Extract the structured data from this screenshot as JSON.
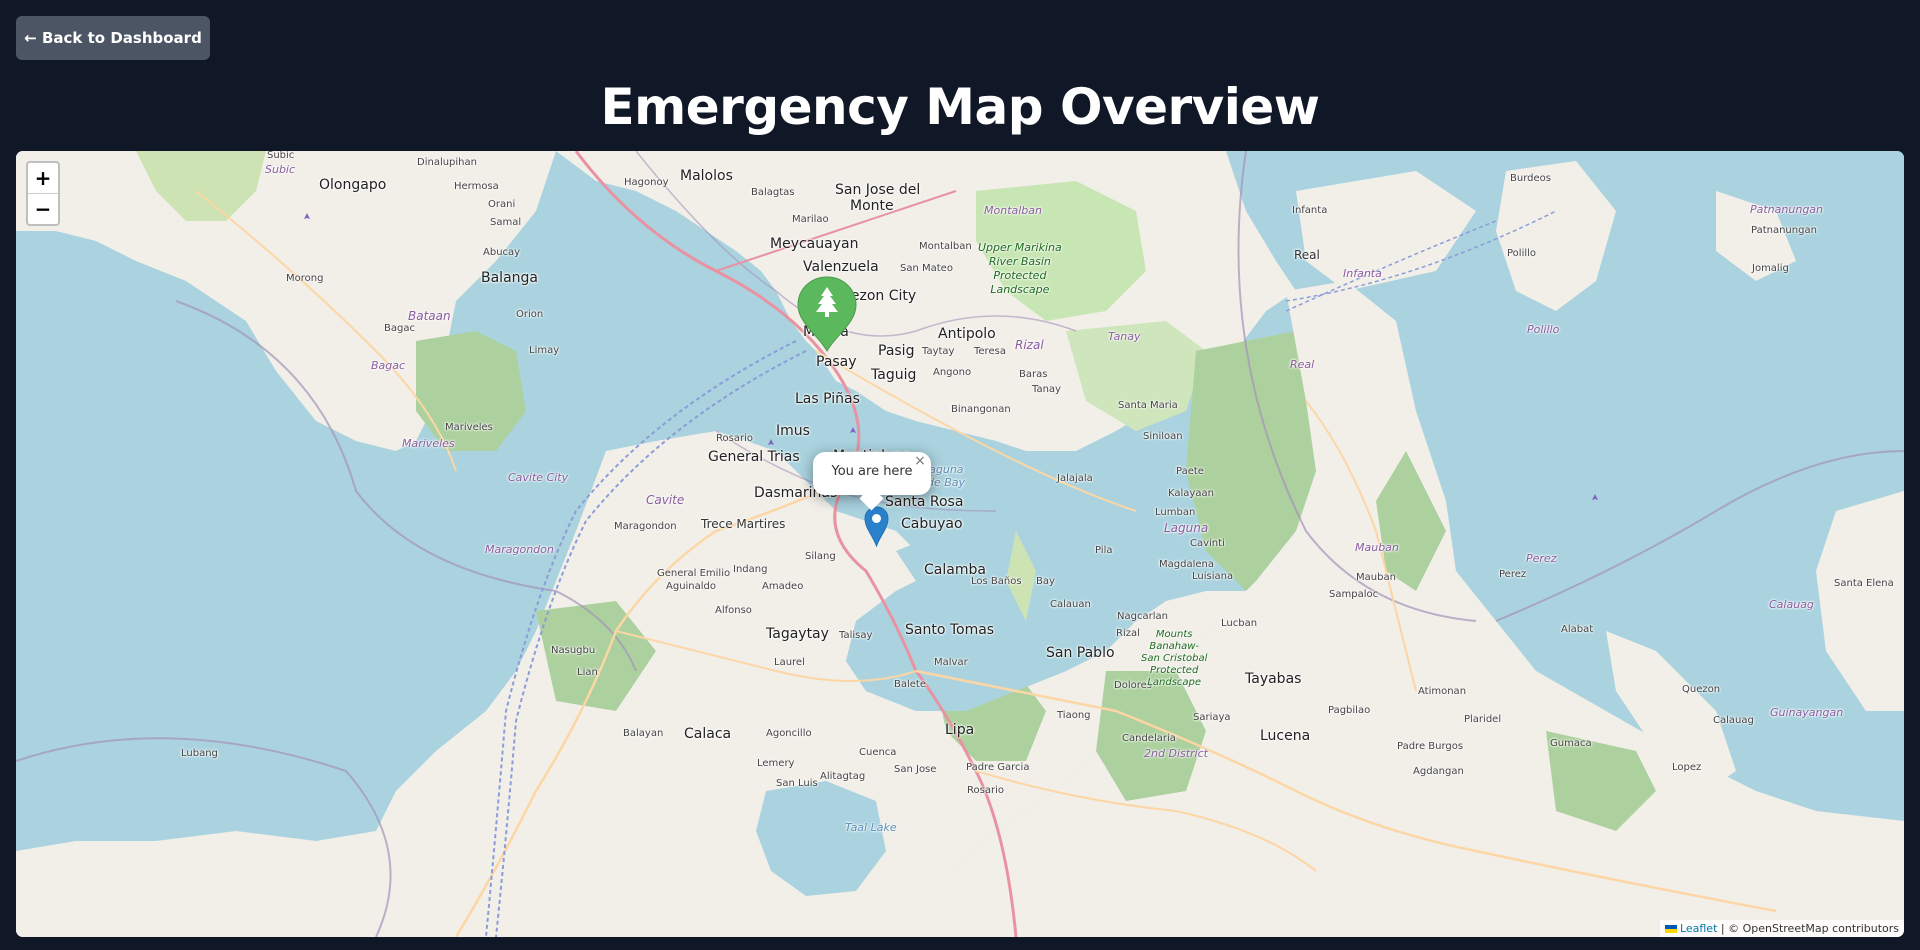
{
  "header": {
    "back_label": "← Back to Dashboard",
    "title": "Emergency Map Overview"
  },
  "map": {
    "zoom_in_label": "+",
    "zoom_out_label": "−",
    "popup_text": "You are here",
    "popup_close": "×",
    "attribution": {
      "leaflet": "Leaflet",
      "separator": " | ",
      "osm": "© OpenStreetMap contributors"
    },
    "markers": [
      {
        "name": "user-location-marker",
        "color": "#2a81cb",
        "icon": "map-pin-icon"
      },
      {
        "name": "evacuation-park-marker",
        "color": "#5cb85c",
        "icon": "tree-icon"
      }
    ],
    "places": {
      "manila": "Manila",
      "quezon": "Quezon City",
      "pasay": "Pasay",
      "pasig": "Pasig",
      "taguig": "Taguig",
      "antipolo": "Antipolo",
      "malolos": "Malolos",
      "sanjose": "San Jose del",
      "sanjose2": "Monte",
      "meycauayan": "Meycauayan",
      "olongapo": "Olongapo",
      "balanga": "Balanga",
      "muntinlupa": "Muntinlupa",
      "imus": "Imus",
      "generaltrias": "General Trias",
      "dasmarinas": "Dasmariñas",
      "santarosa": "Santa Rosa",
      "cabuyao": "Cabuyao",
      "calamba": "Calamba",
      "tagaytay": "Tagaytay",
      "santotomas": "Santo Tomas",
      "sanpablo": "San Pablo",
      "tayabas": "Tayabas",
      "lucena": "Lucena",
      "lipa": "Lipa",
      "calaca": "Calaca",
      "tremartires": "Trece Martires",
      "infanta": "Infanta",
      "real": "Real",
      "polillo": "Polillo",
      "burdeos": "Burdeos",
      "patnanungan": "Patnanungan",
      "jomalig": "Jomalig",
      "mauban": "Mauban",
      "sampaloc": "Sampaloc",
      "lubang": "Lubang",
      "mariveles": "Mariveles",
      "bagac": "Bagac",
      "morong": "Morong",
      "orion": "Orion",
      "limay": "Limay",
      "hermosa": "Hermosa",
      "dinalupihan": "Dinalupihan",
      "subic": "Subic",
      "samal": "Samal",
      "abucay": "Abucay",
      "orani": "Orani",
      "hagonoy": "Hagonoy",
      "balagtas": "Balagtas",
      "marilao": "Marilao",
      "montalban": "Montalban",
      "sanmateo": "San Mateo",
      "taytay": "Taytay",
      "teresa": "Teresa",
      "angono": "Angono",
      "baras": "Baras",
      "tanay": "Tanay",
      "binangonan": "Binangonan",
      "santamaria": "Santa Maria",
      "siniloan": "Siniloan",
      "paete": "Paete",
      "kalayaan": "Kalayaan",
      "lumban": "Lumban",
      "jalajala": "Jalajala",
      "cavinti": "Cavinti",
      "pila": "Pila",
      "magdalena": "Magdalena",
      "luisiana": "Luisiana",
      "bay": "Bay",
      "losbanos": "Los Baños",
      "calauan": "Calauan",
      "nagcarlan": "Nagcarlan",
      "rizaltown": "Rizal",
      "lucban": "Lucban",
      "dolores": "Dolores",
      "tiaong": "Tiaong",
      "candelaria": "Candelaria",
      "sariaya": "Sariaya",
      "pagbilao": "Pagbilao",
      "atimonan": "Atimonan",
      "plaridel": "Plaridel",
      "padreburgos": "Padre Burgos",
      "agdangan": "Agdangan",
      "gumaca": "Gumaca",
      "lopez": "Lopez",
      "calauag": "Calauag",
      "quezontown": "Quezon",
      "alabat": "Alabat",
      "perez": "Perez",
      "santaelena": "Santa Elena",
      "guinayangan": "Guinayangan",
      "rosario": "Rosario",
      "maragondon": "Maragondon",
      "silang": "Silang",
      "indang": "Indang",
      "amadeo": "Amadeo",
      "generalemilio": "General Emilio",
      "aguinaldo": "Aguinaldo",
      "alfonso": "Alfonso",
      "nasugbu": "Nasugbu",
      "lian": "Lian",
      "talisay": "Talisay",
      "laurel": "Laurel",
      "malvar": "Malvar",
      "balete": "Balete",
      "balayan": "Balayan",
      "agoncillo": "Agoncillo",
      "lemery": "Lemery",
      "alitagtag": "Alitagtag",
      "cuenca": "Cuenca",
      "sanluis": "San Luis",
      "sanjosebat": "San Jose",
      "padregarcia": "Padre Garcia",
      "rosariobat": "Rosario",
      "seconddistrict": "2nd District",
      "laspinas": "Las Piñas",
      "lagunadebay": "Laguna",
      "lagunadebay2": "de Bay",
      "taalake": "Taal Lake",
      "valenzuela": "Valenzuela"
    },
    "regions": {
      "bataan": "Bataan",
      "cavite": "Cavite",
      "cavitecity": "Cavite City",
      "laguna": "Laguna",
      "rizal": "Rizal",
      "bagac_admin": "Bagac",
      "mariveles_admin": "Mariveles",
      "maragondon_admin": "Maragondon",
      "infanta_admin": "Infanta",
      "real_admin": "Real",
      "polillo_admin": "Polillo",
      "patnanungan_admin": "Patnanungan",
      "montalban_admin": "Montalban",
      "tanay_admin": "Tanay",
      "mauban_admin": "Mauban",
      "perez_admin": "Perez",
      "calauag_admin": "Calauag",
      "guinayangan_admin": "Guinayangan",
      "subic_admin": "Subic"
    },
    "parks": {
      "marikina": "Upper Marikina\nRiver Basin\nProtected\nLandscape",
      "banahaw": "Mounts\nBanahaw-\nSan Cristobal\nProtected\nLandscape"
    }
  }
}
